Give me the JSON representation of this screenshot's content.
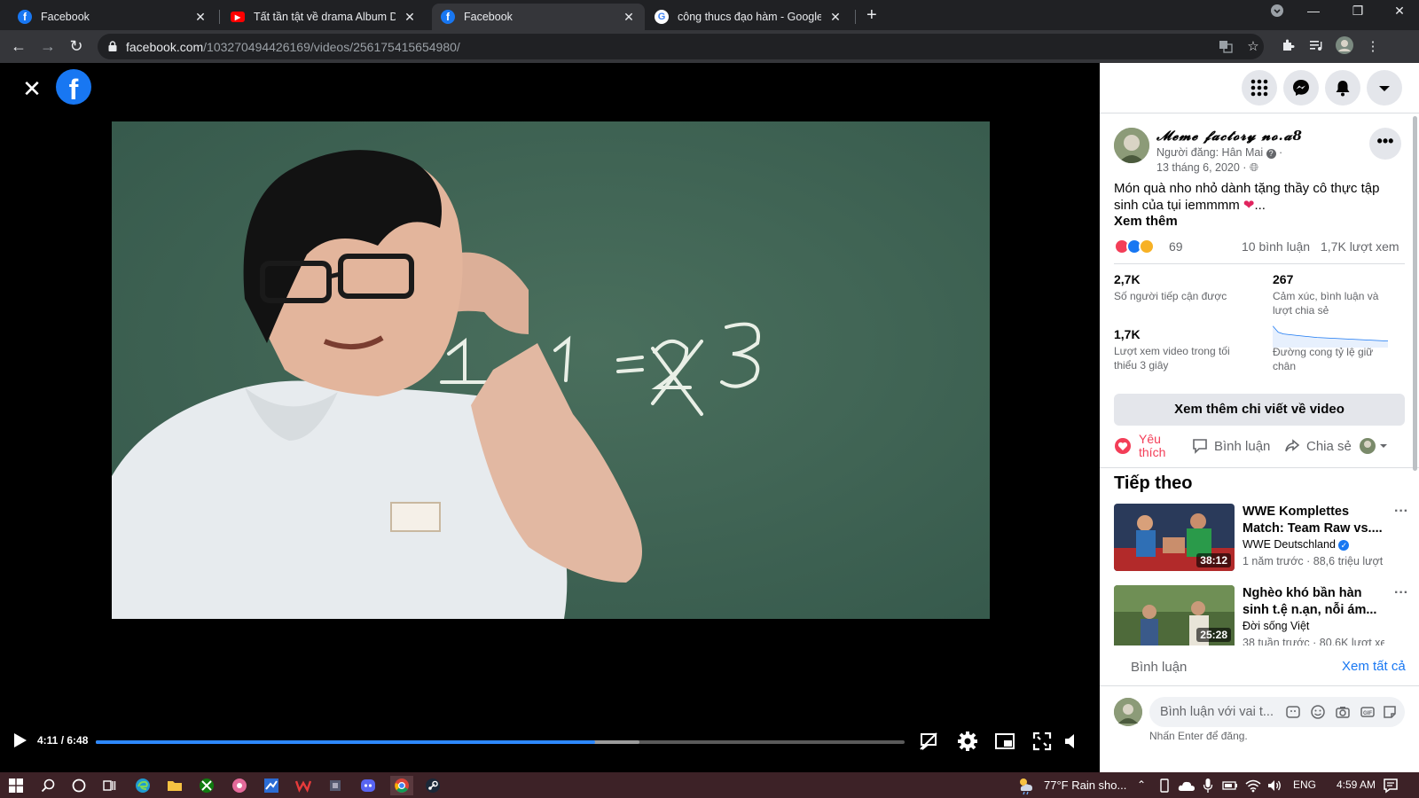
{
  "browser": {
    "tabs": [
      {
        "title": "Facebook",
        "icon": "facebook-icon",
        "active": false
      },
      {
        "title": "Tất tần tật về drama Album DON",
        "icon": "youtube-icon",
        "active": false
      },
      {
        "title": "Facebook",
        "icon": "facebook-icon",
        "active": true
      },
      {
        "title": "công thucs đạo hàm - Google Se",
        "icon": "google-icon",
        "active": false
      }
    ],
    "url_host": "facebook.com",
    "url_path": "/103270494426169/videos/256175415654980/"
  },
  "video": {
    "time": "4:11 / 6:48",
    "played_fraction": 0.617,
    "buffered_fraction": 0.672,
    "board_equation": "1 + 1 = 2 3"
  },
  "post": {
    "page_name": "𝓜𝓮𝓶𝓮 𝓯𝓪𝓬𝓽𝓸𝓻𝔂 𝓷𝓸.𝓪8",
    "poster": "Người đăng: Hân Mai",
    "date": "13 tháng 6, 2020 ·",
    "caption": "Món quà nho nhỏ dành tặng thầy cô thực tập sinh của tụi iemmmm",
    "see_more": "Xem thêm",
    "reaction_count": "69",
    "comment_count": "10 bình luận",
    "view_count": "1,7K lượt xem",
    "stats": [
      {
        "value": "2,7K",
        "label": "Số người tiếp cận được"
      },
      {
        "value": "267",
        "label": "Cảm xúc, bình luận và lượt chia sẻ"
      },
      {
        "value": "1,7K",
        "label": "Lượt xem video trong tối thiểu 3 giây"
      },
      {
        "value": "",
        "label": "Đường cong tỷ lệ giữ chân"
      }
    ],
    "insights_button": "Xem thêm chi viết về video",
    "actions": {
      "like": "Yêu thích",
      "comment": "Bình luận",
      "share": "Chia sẻ"
    }
  },
  "up_next": {
    "heading": "Tiếp theo",
    "items": [
      {
        "title": "WWE Komplettes Match: Team Raw vs....",
        "channel": "WWE Deutschland",
        "meta": "1 năm trước · 88,6 triệu lượt",
        "duration": "38:12",
        "verified": true
      },
      {
        "title": "Nghèo khó bần hàn sinh t.ệ n.ạn, nỗi ám...",
        "channel": "Đời sống Việt",
        "meta": "38 tuần trước · 80,6K lượt xe",
        "duration": "25:28",
        "verified": false
      }
    ]
  },
  "comments": {
    "heading": "Bình luận",
    "see_all": "Xem tất cả",
    "placeholder": "Bình luận với vai t...",
    "hint": "Nhấn Enter để đăng."
  },
  "taskbar": {
    "weather": "77°F  Rain sho...",
    "language": "ENG",
    "clock": "4:59 AM"
  },
  "colors": {
    "fb_blue": "#1877f2",
    "progress": "#2d88ff",
    "taskbar": "#3d2227",
    "chalkboard": "#3f6453"
  }
}
